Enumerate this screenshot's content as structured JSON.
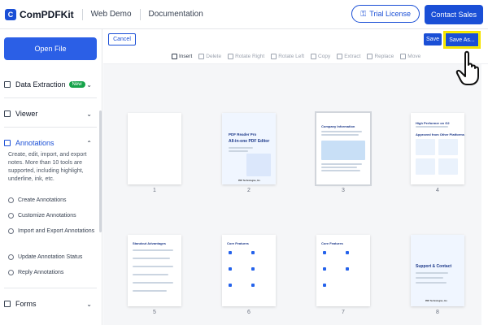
{
  "header": {
    "logo_mark": "C",
    "logo_text": "ComPDFKit",
    "nav": [
      "Web Demo",
      "Documentation"
    ],
    "trial_label": "Trial License",
    "contact_label": "Contact Sales"
  },
  "sidebar": {
    "open_file": "Open File",
    "sections": {
      "data_extraction": "Data Extraction",
      "new_badge": "New",
      "viewer": "Viewer",
      "annotations": "Annotations",
      "forms": "Forms"
    },
    "annotations_desc": "Create, edit, import, and export notes. More than 10 tools are supported, including highlight, underline, ink, etc.",
    "annotation_items": [
      "Create Annotations",
      "Customize Annotations",
      "Import and Export Annotations",
      "Update Annotation Status",
      "Reply Annotations"
    ],
    "chevron": "⌄"
  },
  "toolbar": {
    "cancel": "Cancel",
    "save": "Save",
    "save_as": "Save As...",
    "tools": [
      "Insert",
      "Delete",
      "Rotate Right",
      "Rotate Left",
      "Copy",
      "Extract",
      "Replace",
      "Move"
    ]
  },
  "pages": {
    "numbers": [
      "1",
      "2",
      "3",
      "4",
      "5",
      "6",
      "7",
      "8"
    ],
    "p2_title": "PDF Reader Pro",
    "p2_subtitle": "All-in-one PDF Editor",
    "p3_title": "Company Information",
    "p4_title": "High Performer on G2",
    "p4_sub": "Approved from Other Platforms",
    "p5_title": "Standout Advantages",
    "p6_title": "Core Features",
    "p7_title": "Core Features",
    "p8_title": "Support & Contact",
    "footer": "PDF Technologies, Inc."
  },
  "colors": {
    "brand": "#1a4fd6",
    "highlight": "#fffb00",
    "new_badge": "#16a34a"
  }
}
